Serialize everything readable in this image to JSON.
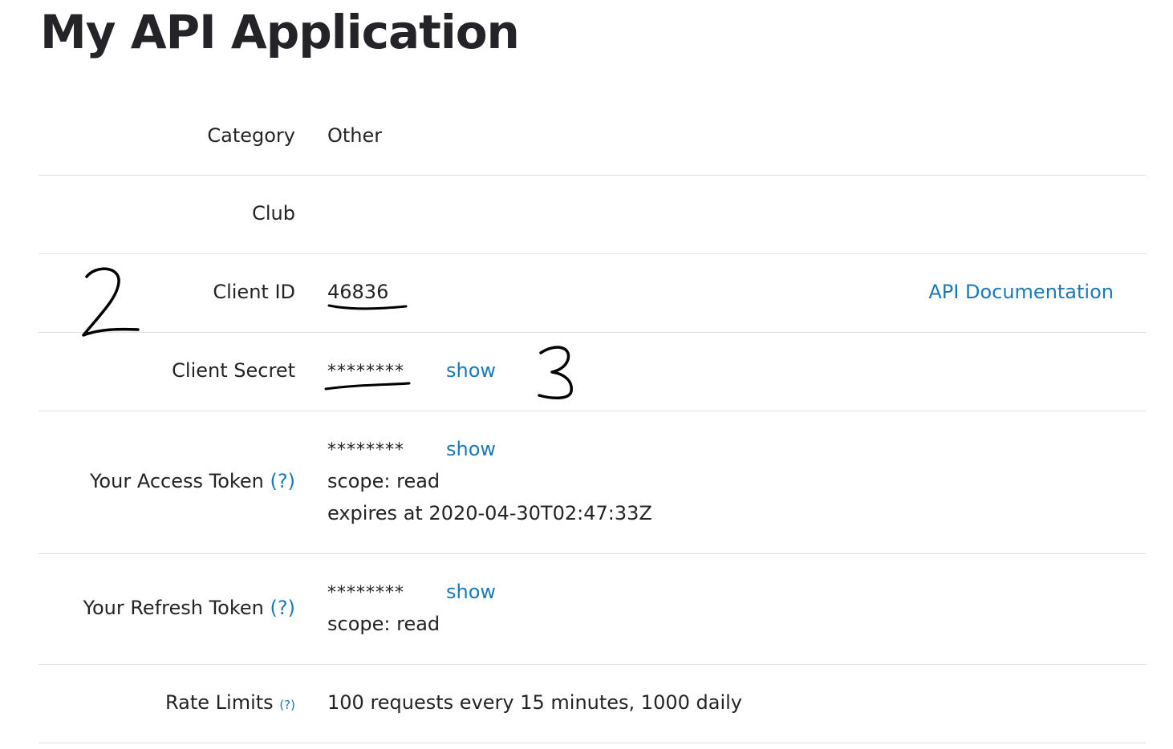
{
  "page": {
    "title": "My API Application"
  },
  "rows": {
    "category": {
      "label": "Category",
      "value": "Other"
    },
    "club": {
      "label": "Club",
      "value": ""
    },
    "client_id": {
      "label": "Client ID",
      "value": "46836",
      "doc_link": "API Documentation"
    },
    "client_secret": {
      "label": "Client Secret",
      "masked": "********",
      "show_label": "show"
    },
    "access_token": {
      "label": "Your Access Token",
      "help": "(?)",
      "masked": "********",
      "show_label": "show",
      "scope": "scope: read",
      "expires": "expires at 2020-04-30T02:47:33Z"
    },
    "refresh_token": {
      "label": "Your Refresh Token",
      "help": "(?)",
      "masked": "********",
      "show_label": "show",
      "scope": "scope: read"
    },
    "rate_limits": {
      "label": "Rate Limits",
      "help": "(?)",
      "value": "100 requests every 15 minutes, 1000 daily"
    }
  },
  "annotations": {
    "mark_2": "2",
    "mark_3": "3"
  },
  "colors": {
    "text": "#242428",
    "link": "#1a79b8",
    "divider": "#dfdfe4",
    "background": "#ffffff"
  }
}
